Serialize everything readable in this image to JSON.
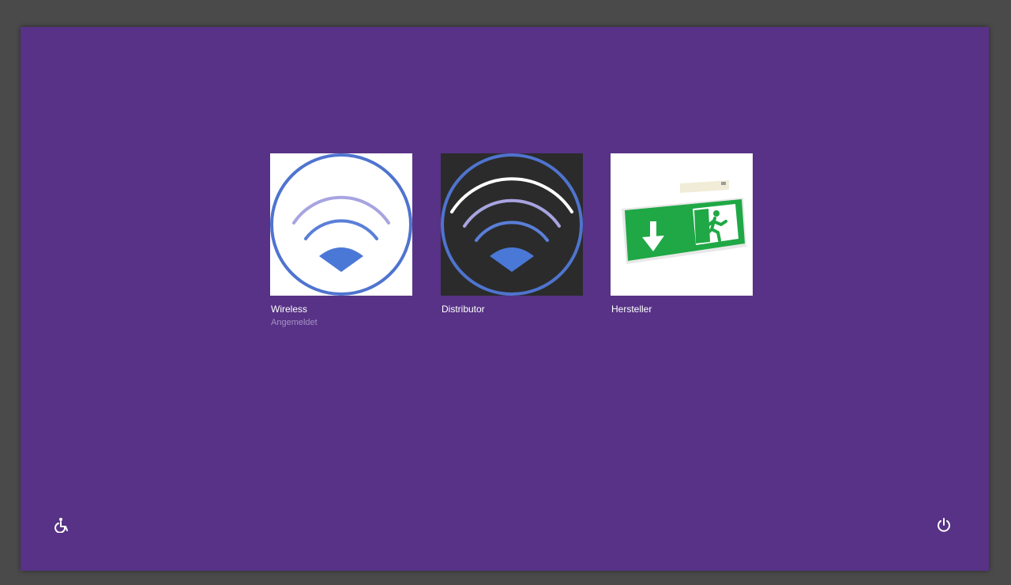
{
  "screen": {
    "background_color": "#573286",
    "frame_color": "#4a4a4a"
  },
  "users": [
    {
      "name": "Wireless",
      "status": "Angemeldet",
      "avatar_icon": "wifi-circle-icon",
      "avatar_background": "#ffffff"
    },
    {
      "name": "Distributor",
      "status": "",
      "avatar_icon": "wifi-circle-icon",
      "avatar_background": "#2b2b2b"
    },
    {
      "name": "Hersteller",
      "status": "",
      "avatar_icon": "emergency-exit-sign-icon",
      "avatar_background": "#ffffff"
    }
  ],
  "corner_controls": {
    "ease_of_access_icon": "ease-of-access-icon",
    "power_icon": "power-icon"
  },
  "colors": {
    "accent_blue": "#4a78d6",
    "circle_blue": "#4f74cf",
    "exit_green": "#1fa845",
    "status_text": "#a592c8"
  }
}
